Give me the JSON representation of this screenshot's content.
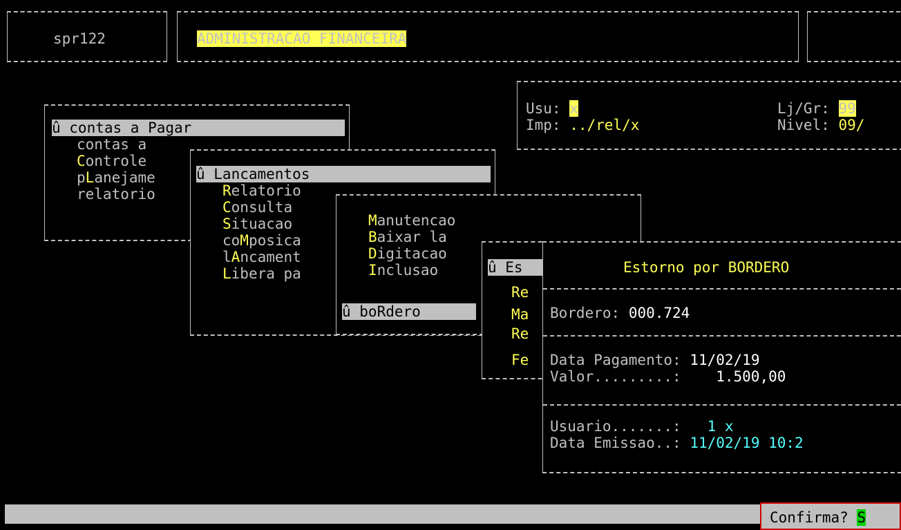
{
  "header": {
    "program": "spr122",
    "title": "ADMINISTRACAO FINANCEIRA"
  },
  "info": {
    "usu_label": "Usu:",
    "usu_value": "x",
    "lj_label": "Lj/Gr:",
    "lj_value": "99",
    "imp_label": "Imp:",
    "imp_value": "../rel/x",
    "nivel_label": "Nivel:",
    "nivel_value": "09/"
  },
  "menu1": {
    "selected": "û contas a Pagar",
    "items": [
      {
        "hot": "",
        "rest": "contas a"
      },
      {
        "hot": "C",
        "rest": "ontrole"
      },
      {
        "pre": "p",
        "hot": "L",
        "rest": "aneja me"
      },
      {
        "pre": "",
        "hot": "",
        "rest": "relatorio"
      }
    ]
  },
  "menu2": {
    "selected": "û Lancamentos",
    "items": [
      {
        "pre": "",
        "hot": "R",
        "rest": "elatorio"
      },
      {
        "pre": "",
        "hot": "C",
        "rest": "onsulta"
      },
      {
        "pre": "",
        "hot": "S",
        "rest": "ituacao"
      },
      {
        "pre": "co",
        "hot": "M",
        "rest": "posica"
      },
      {
        "pre": "l",
        "hot": "A",
        "rest": "ncament"
      },
      {
        "pre": "",
        "hot": "L",
        "rest": "ibera pa"
      }
    ]
  },
  "menu3": {
    "items": [
      {
        "pre": "",
        "hot": "M",
        "rest": "anutencao"
      },
      {
        "pre": "",
        "hot": "B",
        "rest": "aixar la"
      },
      {
        "pre": "",
        "hot": "D",
        "rest": "igitacao"
      },
      {
        "pre": "",
        "hot": "I",
        "rest": "nclusao"
      }
    ],
    "selected": "û boRdero"
  },
  "menu4": {
    "selected": "û Es",
    "items": [
      "Re",
      "Ma",
      "Re",
      "Fe"
    ]
  },
  "dialog": {
    "title": "Estorno por BORDERO",
    "bordero_label": "Bordero:",
    "bordero_value": "000.724",
    "data_pag_label": "Data Pagamento:",
    "data_pag_value": "11/02/19",
    "valor_label": "Valor.........:",
    "valor_value": "1.500,00",
    "usuario_label": "Usuario.......:",
    "usuario_value": "1 x",
    "emissao_label": "Data Emissao..:",
    "emissao_value": "11/02/19 10:2"
  },
  "status": {
    "confirm_label": "Confirma?",
    "confirm_value": "S"
  }
}
